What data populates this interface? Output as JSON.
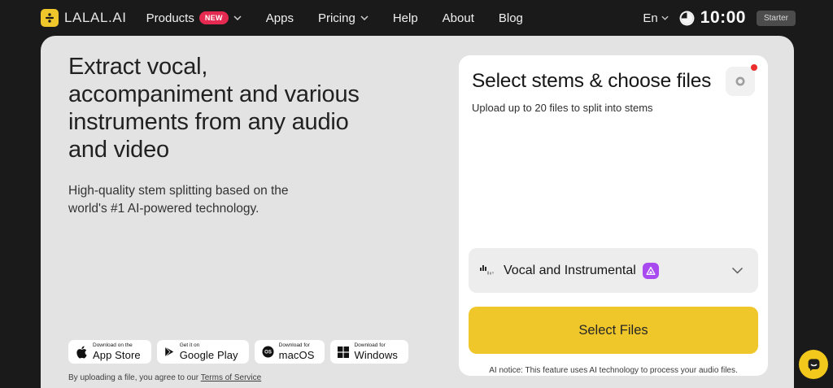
{
  "colors": {
    "accent_yellow": "#EFC72B",
    "badge_red": "#E42A50",
    "alert_red": "#ED2C2C",
    "model_purple": "#A94AF0",
    "dark_background": "#1A1A1A",
    "surface_gray": "#E3E3E3"
  },
  "navbar": {
    "brand": "LALAL.AI",
    "items": [
      {
        "label": "Products",
        "badge": "NEW"
      },
      {
        "label": "Apps"
      },
      {
        "label": "Pricing"
      },
      {
        "label": "Help"
      },
      {
        "label": "About"
      },
      {
        "label": "Blog"
      }
    ],
    "language": "En",
    "minutes_left": "10:00",
    "plan": "Starter"
  },
  "hero": {
    "title": "Extract vocal, accompaniment and various instruments from any audio and video",
    "subtitle": "High-quality stem splitting based on the world's #1 AI-powered technology."
  },
  "stores": {
    "app_store": {
      "top": "Download on the",
      "label": "App Store"
    },
    "google_play": {
      "top": "Get it on",
      "label": "Google Play"
    },
    "macos": {
      "top": "Download for",
      "label": "macOS"
    },
    "windows": {
      "top": "Download for",
      "label": "Windows"
    }
  },
  "terms": {
    "prefix": "By uploading a file, you agree to our ",
    "link": "Terms of Service"
  },
  "card": {
    "title": "Select stems & choose files",
    "subtitle": "Upload up to 20 files to split into stems",
    "stem_option": "Vocal and Instrumental",
    "select_files": "Select Files",
    "ai_notice": "AI notice: This feature uses AI technology to process your audio files."
  },
  "icons": {
    "logo": "division-sign on yellow square",
    "chevron-down": "v caret",
    "clock": "white pie-timer circle",
    "gear": "gray ring",
    "waveform": "two-tone equalizer bars",
    "model-badge": "white triangle on purple square",
    "apple": "apple silhouette",
    "google-play": "play triangle",
    "macos": "OS circle",
    "windows": "four-pane grid",
    "chat": "dark speech bubble on yellow circle"
  }
}
